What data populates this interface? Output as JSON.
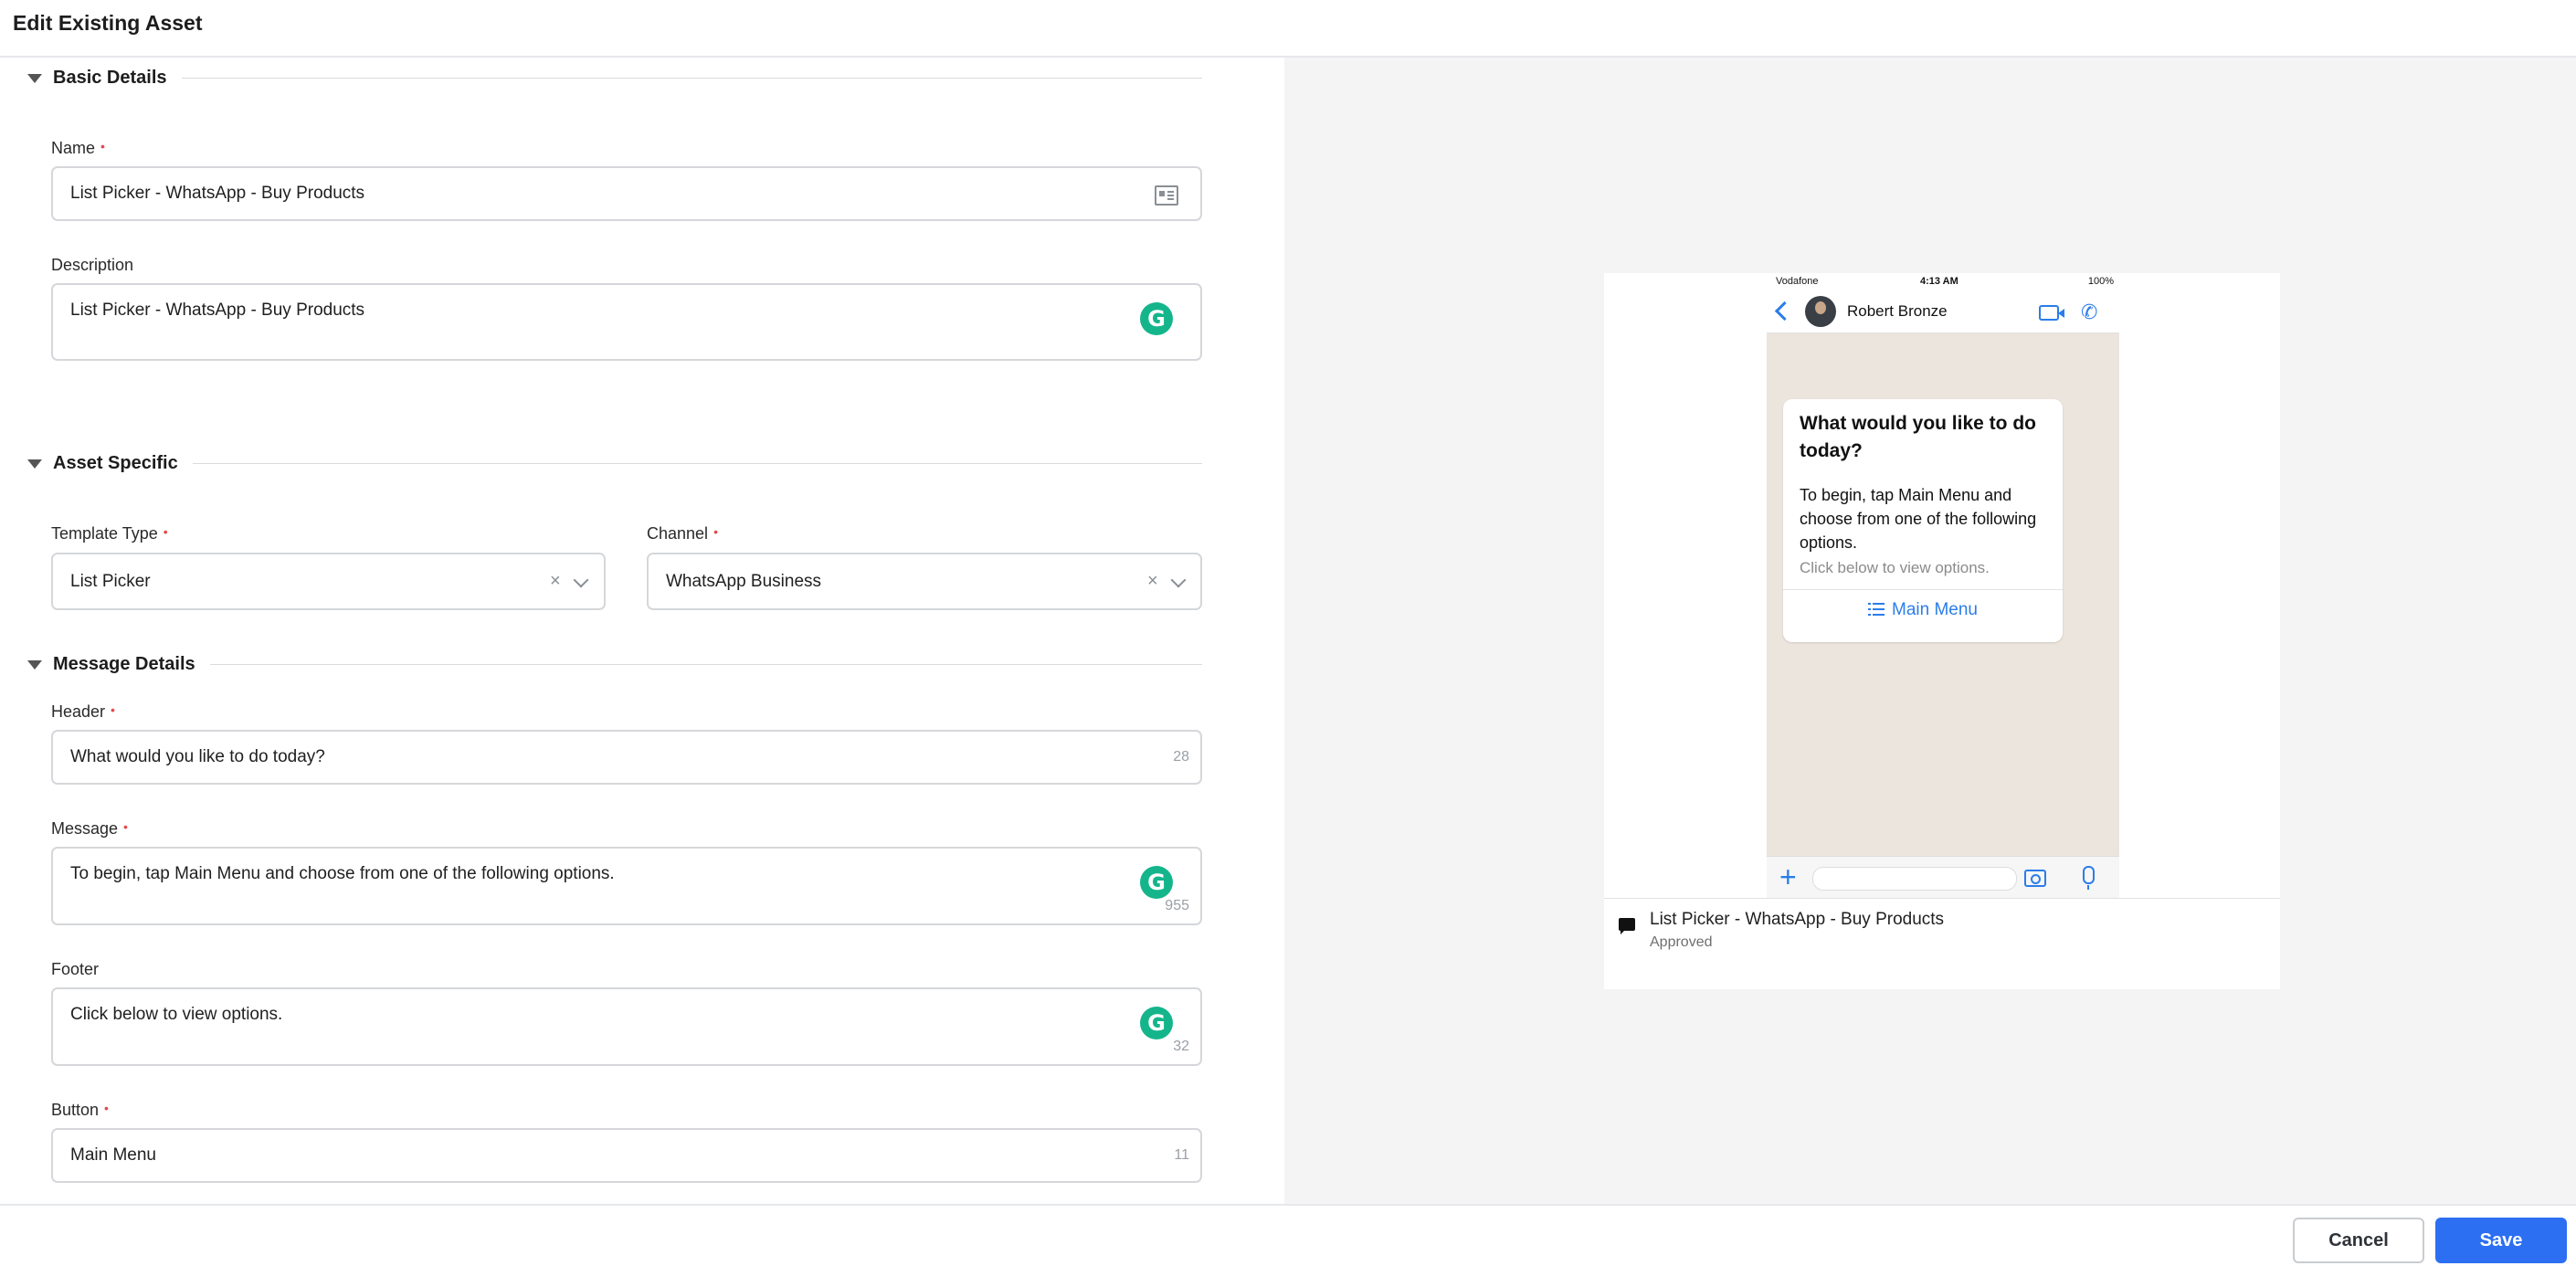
{
  "page": {
    "title": "Edit Existing Asset"
  },
  "sections": {
    "basic": "Basic Details",
    "asset": "Asset Specific",
    "message": "Message Details"
  },
  "fields": {
    "name": {
      "label": "Name",
      "value": "List Picker - WhatsApp - Buy Products"
    },
    "description": {
      "label": "Description",
      "value": "List Picker - WhatsApp - Buy Products"
    },
    "template_type": {
      "label": "Template Type",
      "value": "List Picker"
    },
    "channel": {
      "label": "Channel",
      "value": "WhatsApp Business"
    },
    "header": {
      "label": "Header",
      "value": "What would you like to do today?",
      "count": "28"
    },
    "message": {
      "label": "Message",
      "value": "To begin, tap Main Menu and choose from one of the following options.",
      "count": "955"
    },
    "footer": {
      "label": "Footer",
      "value": "Click below to view options.",
      "count": "32"
    },
    "button": {
      "label": "Button",
      "value": "Main Menu",
      "count": "11"
    }
  },
  "preview": {
    "status": {
      "carrier": "Vodafone",
      "time": "4:13 AM",
      "battery": "100%"
    },
    "contact": "Robert Bronze",
    "bubble": {
      "header": "What would you like to do today?",
      "message": "To begin, tap Main Menu and choose from one of the following options.",
      "footer": "Click below to view options.",
      "button": "Main Menu"
    },
    "asset_name": "List Picker - WhatsApp - Buy Products",
    "asset_status": "Approved"
  },
  "actions": {
    "cancel": "Cancel",
    "save": "Save"
  },
  "symbols": {
    "required": "•",
    "clear": "×",
    "grammarly": "G",
    "plus": "+",
    "phone": "✆"
  },
  "icons": [
    "id-card-icon",
    "grammarly-icon",
    "clear-icon",
    "chevron-down-icon",
    "back-icon",
    "video-call-icon",
    "phone-icon",
    "list-icon",
    "plus-icon",
    "camera-icon",
    "microphone-icon",
    "chat-icon"
  ],
  "colors": {
    "accent": "#2d6ff2",
    "required": "#e5484d",
    "grammarly": "#15b58c",
    "chat_bg": "#ece5dd"
  }
}
